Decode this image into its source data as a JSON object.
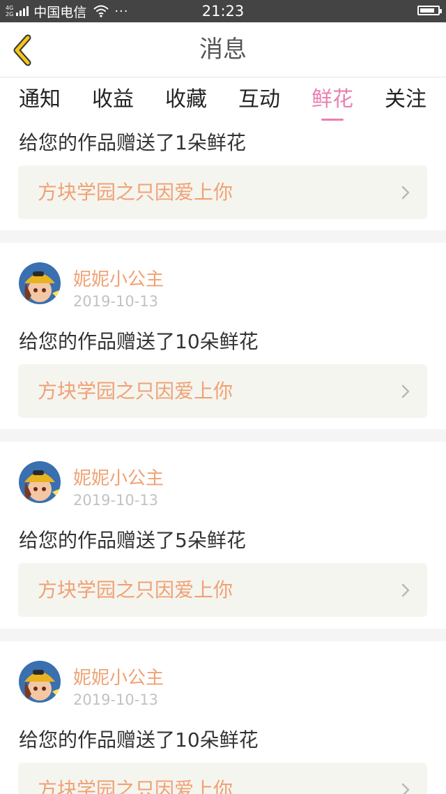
{
  "status_bar": {
    "network_top": "4G",
    "network_bottom": "2G",
    "carrier": "中国电信",
    "more": "···",
    "time": "21:23",
    "battery_level": 0.85
  },
  "nav": {
    "title": "消息",
    "back_icon": "chevron-left-icon"
  },
  "tabs": [
    {
      "label": "通知",
      "active": false
    },
    {
      "label": "收益",
      "active": false
    },
    {
      "label": "收藏",
      "active": false
    },
    {
      "label": "互动",
      "active": false
    },
    {
      "label": "鲜花",
      "active": true
    },
    {
      "label": "关注",
      "active": false
    }
  ],
  "colors": {
    "accent_pink": "#ea7fb1",
    "orange_text": "#f0a173",
    "status_bar": "#444444",
    "back_icon": "#f5c518"
  },
  "messages": [
    {
      "message": "给您的作品赠送了1朵鲜花",
      "work_title": "方块学园之只因爱上你"
    },
    {
      "username": "妮妮小公主",
      "date": "2019-10-13",
      "message": "给您的作品赠送了10朵鲜花",
      "work_title": "方块学园之只因爱上你"
    },
    {
      "username": "妮妮小公主",
      "date": "2019-10-13",
      "message": "给您的作品赠送了5朵鲜花",
      "work_title": "方块学园之只因爱上你"
    },
    {
      "username": "妮妮小公主",
      "date": "2019-10-13",
      "message": "给您的作品赠送了10朵鲜花",
      "work_title": "方块学园之只因爱上你"
    }
  ]
}
